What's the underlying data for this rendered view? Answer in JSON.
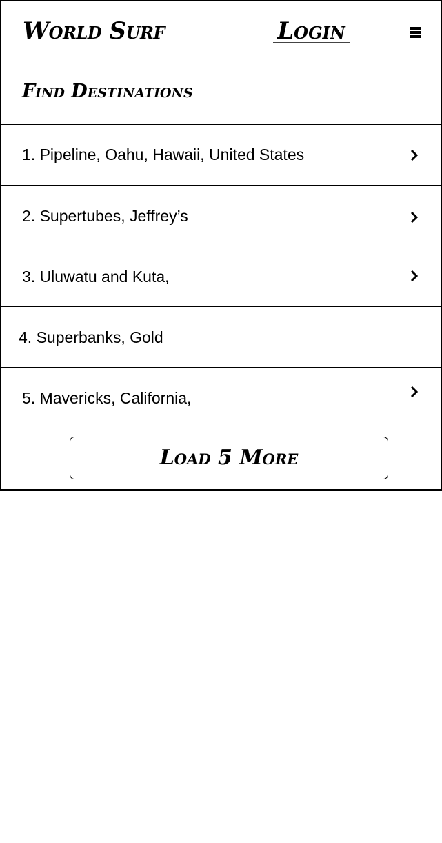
{
  "header": {
    "brand": "World Surf",
    "login_label": "Login",
    "menu_icon": "hamburger-menu-icon"
  },
  "section": {
    "title": "Find Destinations"
  },
  "destinations": [
    {
      "label": "1. Pipeline, Oahu, Hawaii, United States",
      "has_chevron": true
    },
    {
      "label": "2. Supertubes, Jeffrey’s",
      "has_chevron": true
    },
    {
      "label": "3. Uluwatu and Kuta,",
      "has_chevron": true
    },
    {
      "label": "4. Superbanks, Gold",
      "has_chevron": false
    },
    {
      "label": "5. Mavericks, California,",
      "has_chevron": true
    }
  ],
  "load_more": {
    "label": "Load 5 More"
  },
  "colors": {
    "background": "#ffffff",
    "foreground": "#000000"
  }
}
